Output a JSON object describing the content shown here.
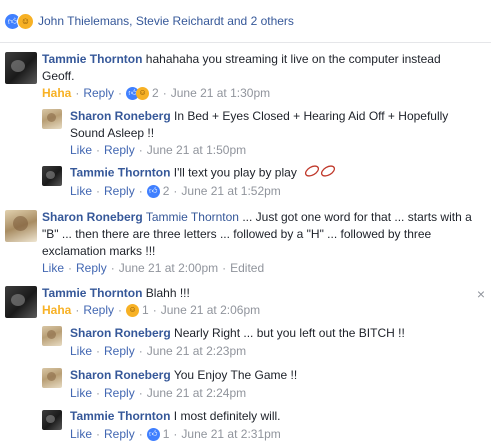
{
  "reactions": {
    "names": "John Thielemans, Stevie Reichardt and 2 others",
    "icons": [
      "like-icon",
      "haha-icon"
    ]
  },
  "comments": [
    {
      "author": "Tammie Thornton",
      "text": "hahahaha you streaming it live on the computer instead Geoff.",
      "reaction_label": "Haha",
      "reply_label": "Reply",
      "badges": [
        "like-icon",
        "haha-icon"
      ],
      "count": "2",
      "time": "June 21 at 1:30pm"
    },
    {
      "author": "Sharon Roneberg",
      "text": "In Bed + Eyes Closed + Hearing Aid Off + Hopefully Sound Asleep !!",
      "reaction_label": "Like",
      "reply_label": "Reply",
      "time": "June 21 at 1:50pm"
    },
    {
      "author": "Tammie Thornton",
      "text": "I'll text you play by play",
      "emoji": "football-icon",
      "reaction_label": "Like",
      "reply_label": "Reply",
      "badges": [
        "like-icon"
      ],
      "count": "2",
      "time": "June 21 at 1:52pm"
    },
    {
      "author": "Sharon Roneberg",
      "mention": "Tammie Thornton",
      "text": "... Just got one word for that ... starts with a \"B\" ... then there are three letters ... followed by a \"H\" ... followed by three exclamation marks !!!",
      "reaction_label": "Like",
      "reply_label": "Reply",
      "time": "June 21 at 2:00pm",
      "edited": "Edited"
    },
    {
      "author": "Tammie Thornton",
      "text": "Blahh !!!",
      "reaction_label": "Haha",
      "reply_label": "Reply",
      "badges": [
        "haha-icon"
      ],
      "count": "1",
      "time": "June 21 at 2:06pm"
    },
    {
      "author": "Sharon Roneberg",
      "text": "Nearly Right ... but you left out the BITCH !!",
      "reaction_label": "Like",
      "reply_label": "Reply",
      "time": "June 21 at 2:23pm"
    },
    {
      "author": "Sharon Roneberg",
      "text": "You Enjoy The Game !!",
      "reaction_label": "Like",
      "reply_label": "Reply",
      "time": "June 21 at 2:24pm"
    },
    {
      "author": "Tammie Thornton",
      "text": "I most definitely will.",
      "reaction_label": "Like",
      "reply_label": "Reply",
      "badges": [
        "like-icon"
      ],
      "count": "1",
      "time": "June 21 at 2:31pm"
    }
  ],
  "separator": "·",
  "close_symbol": "×",
  "colors": {
    "link": "#365899",
    "action": "#4267b2",
    "meta": "#90949c",
    "haha": "#f7b125",
    "like": "#4080ff"
  }
}
